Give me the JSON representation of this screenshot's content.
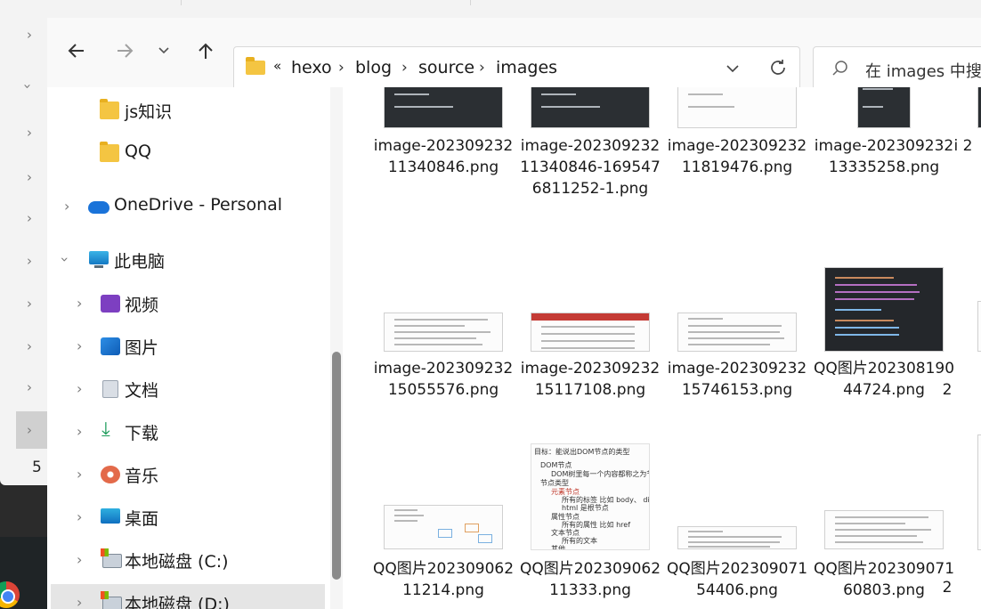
{
  "address_bar": {
    "overflow": "«",
    "crumbs": [
      "hexo",
      "blog",
      "source",
      "images"
    ]
  },
  "search": {
    "placeholder": "在 images 中搜索"
  },
  "nav": {
    "items": [
      {
        "label": "js知识",
        "icon": "folder-icon"
      },
      {
        "label": "QQ",
        "icon": "folder-icon"
      },
      {
        "label": "OneDrive - Personal",
        "icon": "onedrive-cloud-icon"
      },
      {
        "label": "此电脑",
        "icon": "computer-icon"
      },
      {
        "label": "视频",
        "icon": "videos-icon"
      },
      {
        "label": "图片",
        "icon": "pictures-icon"
      },
      {
        "label": "文档",
        "icon": "documents-icon"
      },
      {
        "label": "下载",
        "icon": "downloads-icon"
      },
      {
        "label": "音乐",
        "icon": "music-icon"
      },
      {
        "label": "桌面",
        "icon": "desktop-icon"
      },
      {
        "label": "本地磁盘 (C:)",
        "icon": "drive-icon"
      },
      {
        "label": "本地磁盘 (D:)",
        "icon": "drive-icon"
      }
    ]
  },
  "files": [
    {
      "name": "image-20230923211340846.png"
    },
    {
      "name": "image-20230923211340846-1695476811252-1.png"
    },
    {
      "name": "image-20230923211819476.png"
    },
    {
      "name": "image-20230923213335258.png"
    },
    {
      "name": "i 2"
    },
    {
      "name": "image-20230923215055576.png"
    },
    {
      "name": "image-20230923215117108.png"
    },
    {
      "name": "image-20230923215746153.png"
    },
    {
      "name": "QQ图片20230819044724.png"
    },
    {
      "name": "2"
    },
    {
      "name": "QQ图片20230906211214.png"
    },
    {
      "name": "QQ图片20230906211333.png"
    },
    {
      "name": "QQ图片20230907154406.png"
    },
    {
      "name": "QQ图片20230907160803.png"
    },
    {
      "name": "2"
    }
  ],
  "ppt_preview": {
    "title": "目标：能说出DOM节点的类型",
    "lines": [
      "DOM节点",
      "DOM树里每一个内容都称之为节点",
      "节点类型",
      "元素节点",
      "所有的标签 比如 body、 div",
      "html 是根节点",
      "属性节点",
      "所有的属性 比如 href",
      "文本节点",
      "所有的文本",
      "其他"
    ]
  },
  "background_window": {
    "number": "5"
  }
}
